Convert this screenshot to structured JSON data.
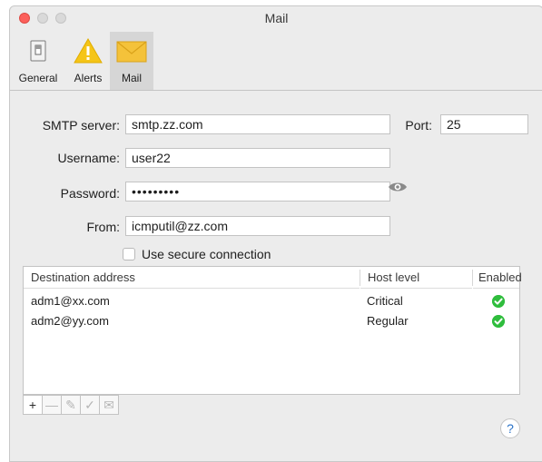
{
  "window": {
    "title": "Mail"
  },
  "toolbar": {
    "items": [
      {
        "label": "General",
        "icon": "switch-icon"
      },
      {
        "label": "Alerts",
        "icon": "warning-icon"
      },
      {
        "label": "Mail",
        "icon": "envelope-icon",
        "selected": true
      }
    ]
  },
  "form": {
    "smtp_label": "SMTP server:",
    "smtp_value": "smtp.zz.com",
    "port_label": "Port:",
    "port_value": "25",
    "username_label": "Username:",
    "username_value": "user22",
    "password_label": "Password:",
    "password_value": "•••••••••",
    "from_label": "From:",
    "from_value": "icmputil@zz.com",
    "secure_label": "Use secure connection",
    "secure_checked": false
  },
  "table": {
    "headers": [
      "Destination address",
      "Host level",
      "Enabled"
    ],
    "rows": [
      {
        "address": "adm1@xx.com",
        "level": "Critical",
        "enabled": true
      },
      {
        "address": "adm2@yy.com",
        "level": "Regular",
        "enabled": true
      }
    ]
  },
  "buttons": {
    "add": "+",
    "remove": "—",
    "edit": "✎",
    "check": "✓",
    "mail": "✉",
    "help": "?"
  },
  "colors": {
    "close": "#fc605b",
    "enabled_check": "#2fbd3d",
    "alert_yellow": "#f5c518",
    "mail_yellow": "#f4c23a"
  }
}
